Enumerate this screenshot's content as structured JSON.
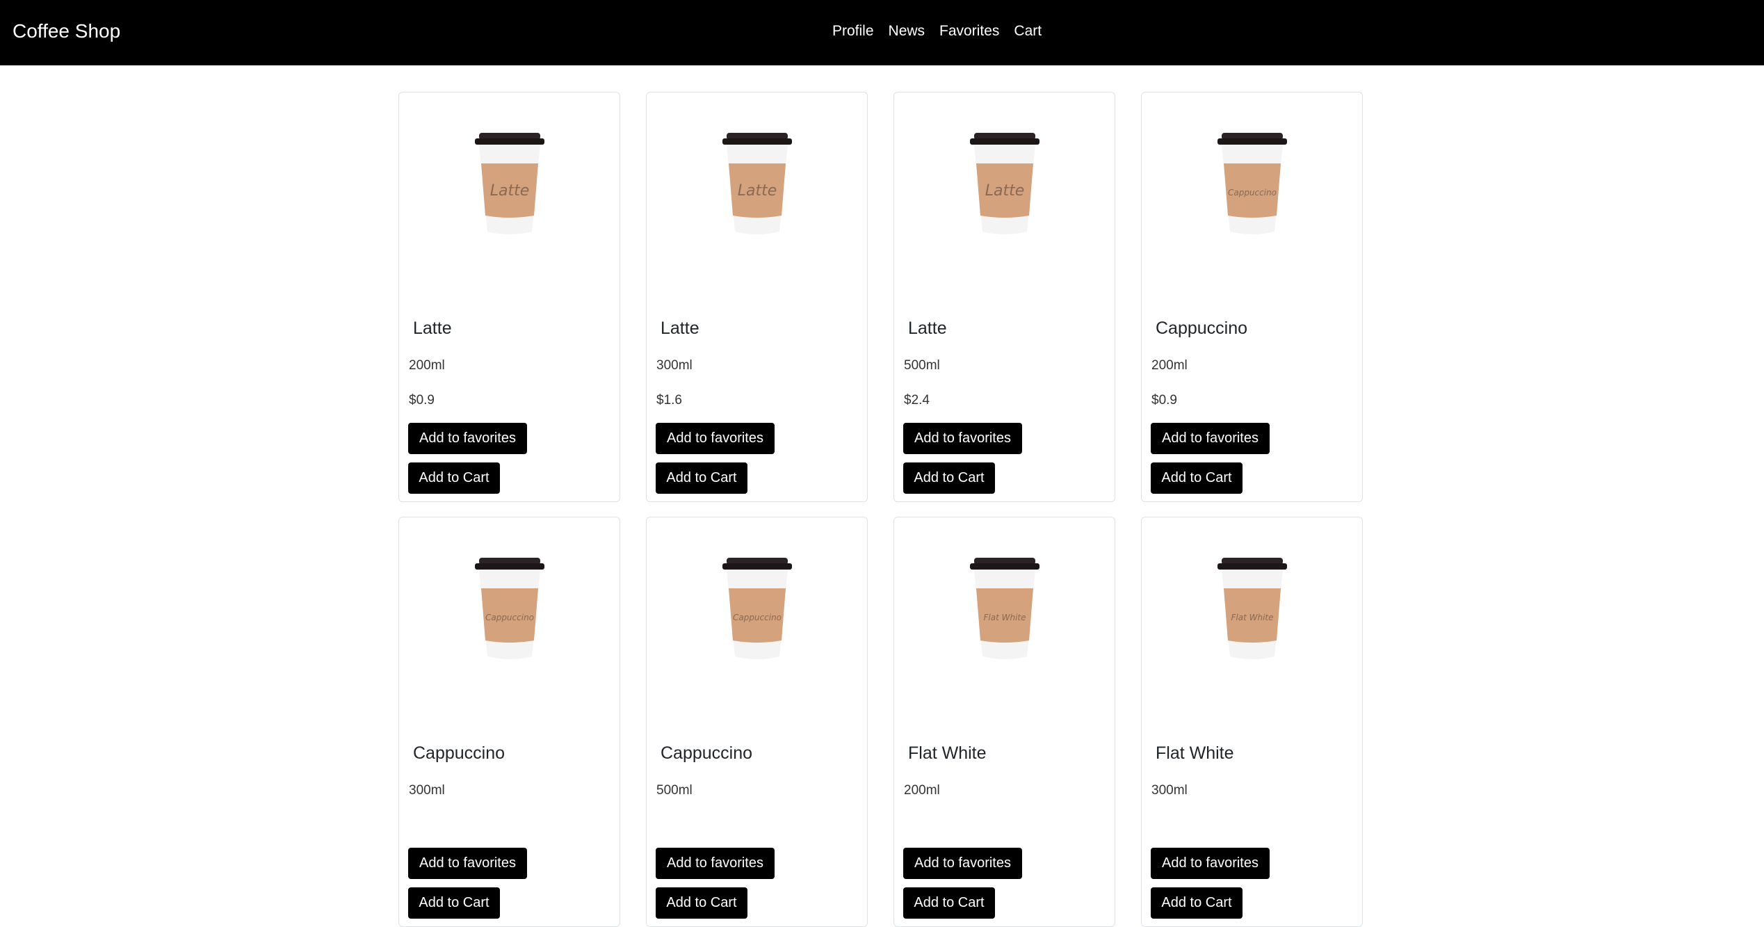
{
  "navbar": {
    "brand": "Coffee Shop",
    "links": [
      "Profile",
      "News",
      "Favorites",
      "Cart"
    ]
  },
  "labels": {
    "add_to_favorites": "Add to favorites",
    "add_to_cart": "Add to Cart"
  },
  "products": [
    {
      "name": "Latte",
      "volume": "200ml",
      "price": "$0.9",
      "cup_text": "Latte"
    },
    {
      "name": "Latte",
      "volume": "300ml",
      "price": "$1.6",
      "cup_text": "Latte"
    },
    {
      "name": "Latte",
      "volume": "500ml",
      "price": "$2.4",
      "cup_text": "Latte"
    },
    {
      "name": "Cappuccino",
      "volume": "200ml",
      "price": "$0.9",
      "cup_text": "Cappuccino"
    },
    {
      "name": "Cappuccino",
      "volume": "300ml",
      "price": "",
      "cup_text": "Cappuccino"
    },
    {
      "name": "Cappuccino",
      "volume": "500ml",
      "price": "",
      "cup_text": "Cappuccino"
    },
    {
      "name": "Flat White",
      "volume": "200ml",
      "price": "",
      "cup_text": "Flat White"
    },
    {
      "name": "Flat White",
      "volume": "300ml",
      "price": "",
      "cup_text": "Flat White"
    }
  ],
  "colors": {
    "navbar_bg": "#000000",
    "button_bg": "#000000",
    "cup_sleeve": "#d4a27c",
    "cup_lid": "#2a2224"
  },
  "icons": {
    "product_image": "coffee-cup-icon"
  }
}
